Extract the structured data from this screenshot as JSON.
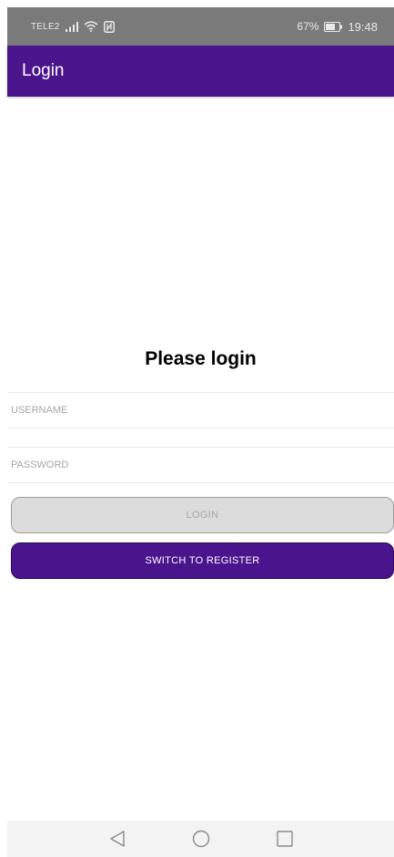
{
  "status_bar": {
    "carrier": "TELE2",
    "battery_percent": "67%",
    "time": "19:48",
    "icons": [
      "signal-icon",
      "wifi-icon",
      "nfc-icon",
      "battery-icon"
    ]
  },
  "app_bar": {
    "title": "Login"
  },
  "form": {
    "heading": "Please login",
    "username": {
      "placeholder": "USERNAME",
      "value": ""
    },
    "password": {
      "placeholder": "PASSWORD",
      "value": ""
    },
    "login_label": "LOGIN",
    "switch_label": "SWITCH TO REGISTER"
  },
  "nav_bar": {
    "icons": [
      "back-icon",
      "home-icon",
      "recents-icon"
    ]
  },
  "colors": {
    "primary": "#4a148c",
    "status_bar": "#7a7a7a",
    "disabled_button": "#dcdcdc",
    "disabled_text": "#a7a7a7",
    "nav_bar": "#f3f3f3"
  }
}
